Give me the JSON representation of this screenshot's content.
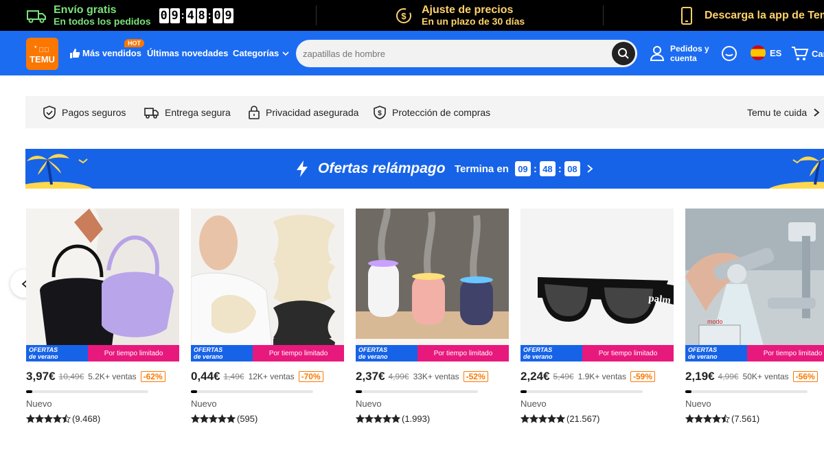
{
  "promo": {
    "shipping_title": "Envío gratis",
    "shipping_sub": "En todos los pedidos",
    "timer": [
      "0",
      "9",
      "4",
      "8",
      "0",
      "9"
    ],
    "price_title": "Ajuste de precios",
    "price_sub": "En un plazo de 30 días",
    "app_text": "Descarga la app de Temu"
  },
  "header": {
    "logo_top": "ﾟ◡ﾟ",
    "logo_word": "TEMU",
    "bestsellers": "Más vendidos",
    "hot_badge": "HOT",
    "new_arrivals": "Últimas novedades",
    "categories": "Categorías",
    "search_placeholder": "zapatillas de hombre",
    "account_line1": "Pedidos y",
    "account_line2": "cuenta",
    "language": "ES",
    "cart": "Carrito"
  },
  "trust": {
    "items": [
      "Pagos seguros",
      "Entrega segura",
      "Privacidad asegurada",
      "Protección de compras"
    ],
    "care": "Temu te cuida"
  },
  "flash": {
    "title": "Ofertas relámpago",
    "ends_label": "Termina en",
    "hh": "09",
    "mm": "48",
    "ss": "08"
  },
  "deal_labels": {
    "summer_line1": "OFERTAS",
    "summer_line2": "de verano",
    "limited": "Por tiempo limitado"
  },
  "products": [
    {
      "price": "3,97€",
      "old": "10,49€",
      "sold": "5.2K+ ventas",
      "discount": "-62%",
      "tag": "Nuevo",
      "reviews": "(9.468)",
      "progress": 0.05,
      "stars": 4.5
    },
    {
      "price": "0,44€",
      "old": "1,49€",
      "sold": "12K+ ventas",
      "discount": "-70%",
      "tag": "Nuevo",
      "reviews": "(595)",
      "progress": 0.05,
      "stars": 5
    },
    {
      "price": "2,37€",
      "old": "4,99€",
      "sold": "33K+ ventas",
      "discount": "-52%",
      "tag": "Nuevo",
      "reviews": "(1.993)",
      "progress": 0.05,
      "stars": 5
    },
    {
      "price": "2,24€",
      "old": "5,49€",
      "sold": "1.9K+ ventas",
      "discount": "-59%",
      "tag": "Nuevo",
      "reviews": "(21.567)",
      "progress": 0.05,
      "stars": 5
    },
    {
      "price": "2,19€",
      "old": "4,99€",
      "sold": "50K+ ventas",
      "discount": "-56%",
      "tag": "Nuevo",
      "reviews": "(7.561)",
      "progress": 0.05,
      "stars": 4.5
    }
  ],
  "colors": {
    "brand_blue": "#1c6cf2",
    "brand_orange": "#fb7701",
    "promo_yellow": "#ffd36b",
    "promo_green": "#7be37b",
    "limited_pink": "#e8197d"
  }
}
